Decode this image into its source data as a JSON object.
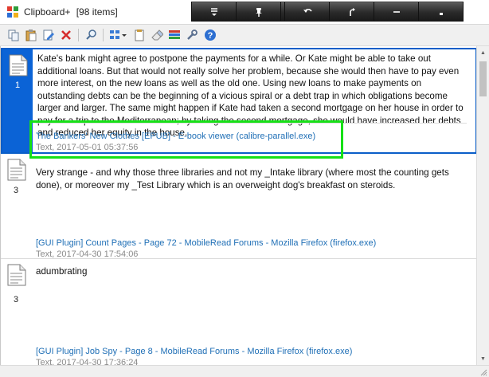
{
  "window": {
    "title": "Clipboard+",
    "item_count": "[98 items]",
    "controls": [
      "menu-dropdown-icon",
      "pin-icon",
      "window-icon",
      "undo-icon",
      "fork-icon",
      "minimize-icon",
      "close-icon"
    ]
  },
  "toolbar": {
    "buttons": [
      "copy-icon",
      "paste-icon",
      "edit-icon",
      "delete-icon",
      "search-icon",
      "view-options-icon",
      "new-clip-icon",
      "eraser-icon",
      "list-icon",
      "tools-icon",
      "help-icon"
    ]
  },
  "clips": [
    {
      "number": "1",
      "selected": true,
      "text": "Kate's bank might agree to postpone the payments for a while. Or Kate might be able to take out additional loans. But that would not really solve her problem, because she would then have to pay even more interest, on the new loans as well as the old one. Using new loans to make payments on outstanding debts can be the beginning of a vicious spiral or a debt trap in which obligations become larger and larger. The same might happen if Kate had taken a second mortgage on her house in order to pay for a trip to the Mediterranean; by taking the second mortgage, she would have increased her debts and reduced her equity in the house.",
      "source": "The Bankers' New Clothes [EPUB] - E-book viewer (calibre-parallel.exe)",
      "meta": "Text, 2017-05-01 05:37:56"
    },
    {
      "number": "3",
      "selected": false,
      "text": "Very strange - and why those three libraries and not my _Intake library (where most the counting gets done), or moreover my _Test Library which is an overweight dog's breakfast on steroids.",
      "source": "[GUI Plugin] Count Pages - Page 72 - MobileRead Forums - Mozilla Firefox (firefox.exe)",
      "meta": "Text, 2017-04-30 17:54:06"
    },
    {
      "number": "3",
      "selected": false,
      "text": "adumbrating",
      "source": "[GUI Plugin] Job Spy - Page 8 - MobileRead Forums - Mozilla Firefox (firefox.exe)",
      "meta": "Text, 2017-04-30 17:36:24"
    }
  ],
  "colors": {
    "selection": "#0b63d6",
    "source_link": "#1f6fb6",
    "highlight_box": "#16e016"
  }
}
